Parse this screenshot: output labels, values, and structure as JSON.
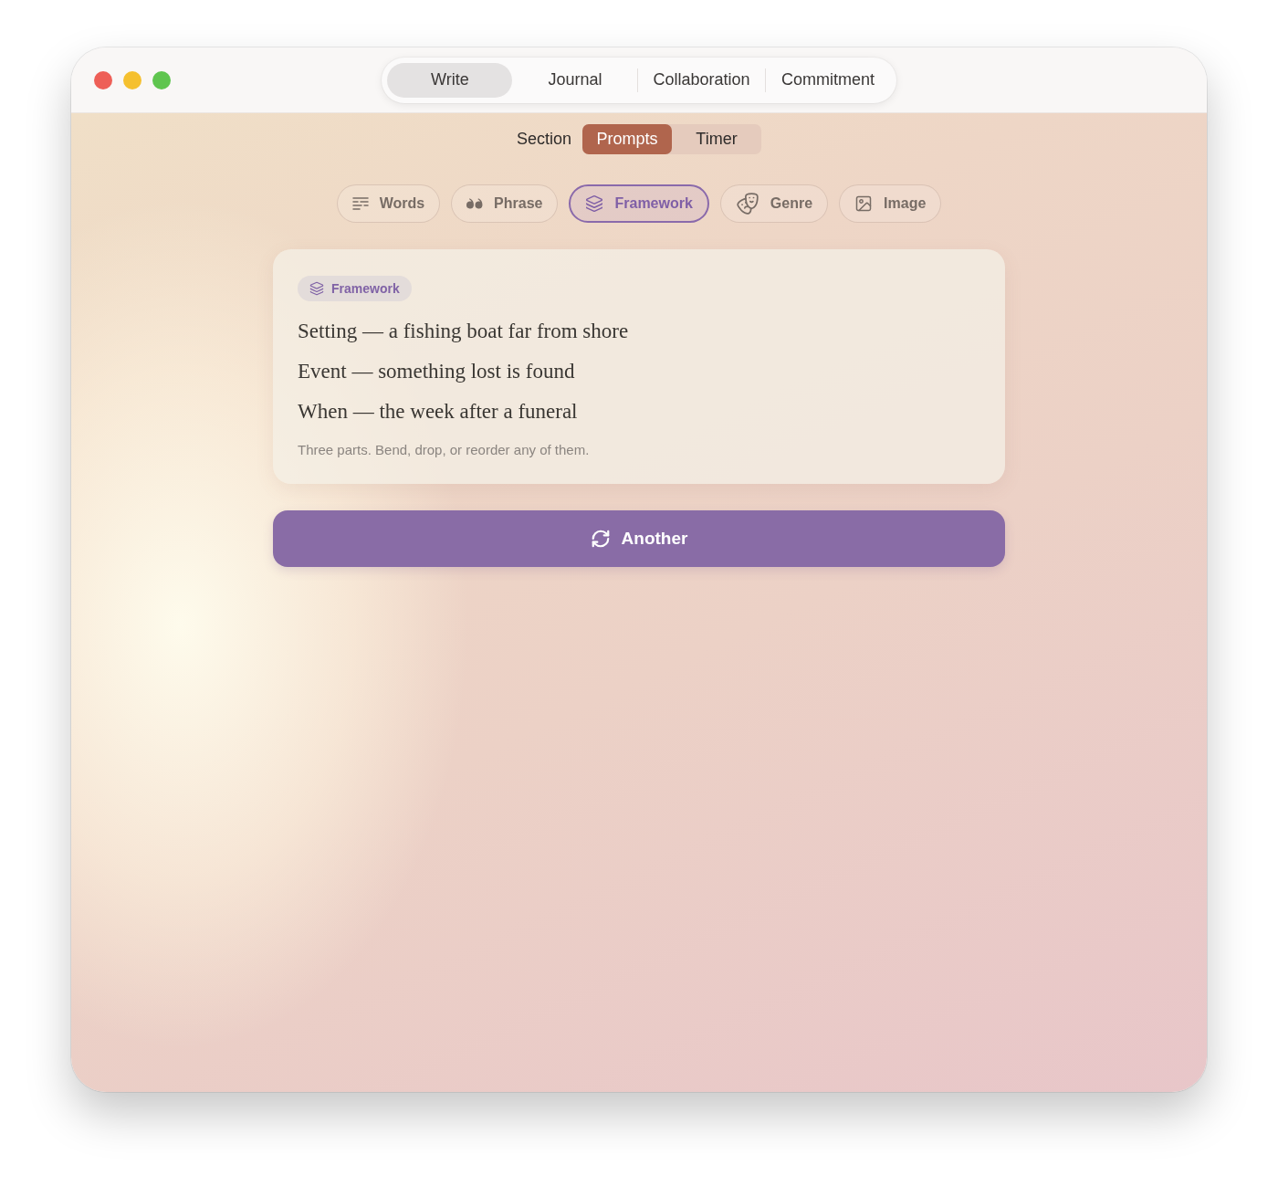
{
  "top_tabs": [
    {
      "label": "Write",
      "selected": true
    },
    {
      "label": "Journal",
      "selected": false
    },
    {
      "label": "Collaboration",
      "selected": false
    },
    {
      "label": "Commitment",
      "selected": false
    }
  ],
  "section_switch": {
    "label": "Section",
    "options": [
      {
        "label": "Prompts",
        "selected": true
      },
      {
        "label": "Timer",
        "selected": false
      }
    ]
  },
  "prompt_types": [
    {
      "kind": "words",
      "label": "Words",
      "selected": false
    },
    {
      "kind": "phrase",
      "label": "Phrase",
      "selected": false
    },
    {
      "kind": "framework",
      "label": "Framework",
      "selected": true
    },
    {
      "kind": "genre",
      "label": "Genre",
      "selected": false
    },
    {
      "kind": "image",
      "label": "Image",
      "selected": false
    }
  ],
  "card": {
    "badge": "Framework",
    "lines": [
      "Setting — a fishing boat far from shore",
      "Event — something lost is found",
      "When — the week after a funeral"
    ],
    "note": "Three parts. Bend, drop, or reorder any of them."
  },
  "action_button": {
    "label": "Another"
  }
}
